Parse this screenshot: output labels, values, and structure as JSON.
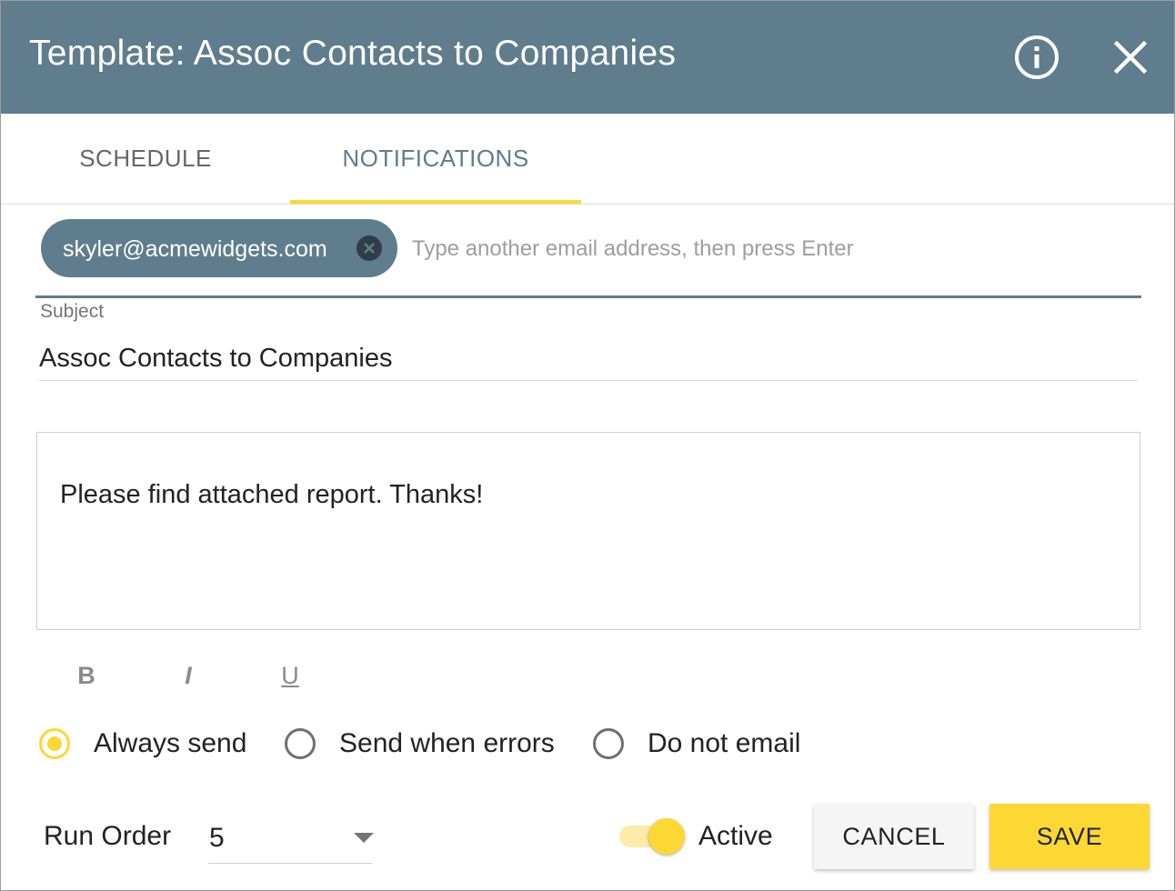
{
  "header": {
    "title": "Template: Assoc Contacts to Companies",
    "info_icon": "info-circle-icon",
    "close_icon": "close-icon"
  },
  "tabs": [
    {
      "label": "SCHEDULE",
      "selected": false
    },
    {
      "label": "NOTIFICATIONS",
      "selected": true
    }
  ],
  "recipients": {
    "chips": [
      {
        "email": "skyler@acmewidgets.com",
        "remove_icon": "cancel-circle-icon"
      }
    ],
    "placeholder": "Type another email address, then press Enter",
    "value": ""
  },
  "subject": {
    "label": "Subject",
    "value": "Assoc Contacts to Companies"
  },
  "body": {
    "text": "Please find attached report. Thanks!"
  },
  "format_toolbar": {
    "bold": "B",
    "italic": "I",
    "underline": "U"
  },
  "send_options": [
    {
      "label": "Always send",
      "checked": true
    },
    {
      "label": "Send when errors",
      "checked": false
    },
    {
      "label": "Do not email",
      "checked": false
    }
  ],
  "run_order": {
    "label": "Run Order",
    "value": "5"
  },
  "active": {
    "label": "Active",
    "on": true
  },
  "actions": {
    "cancel": "CANCEL",
    "save": "SAVE"
  },
  "colors": {
    "header": "#5f7d8c",
    "accent": "#fdd835",
    "chip": "#5f7d8c"
  }
}
